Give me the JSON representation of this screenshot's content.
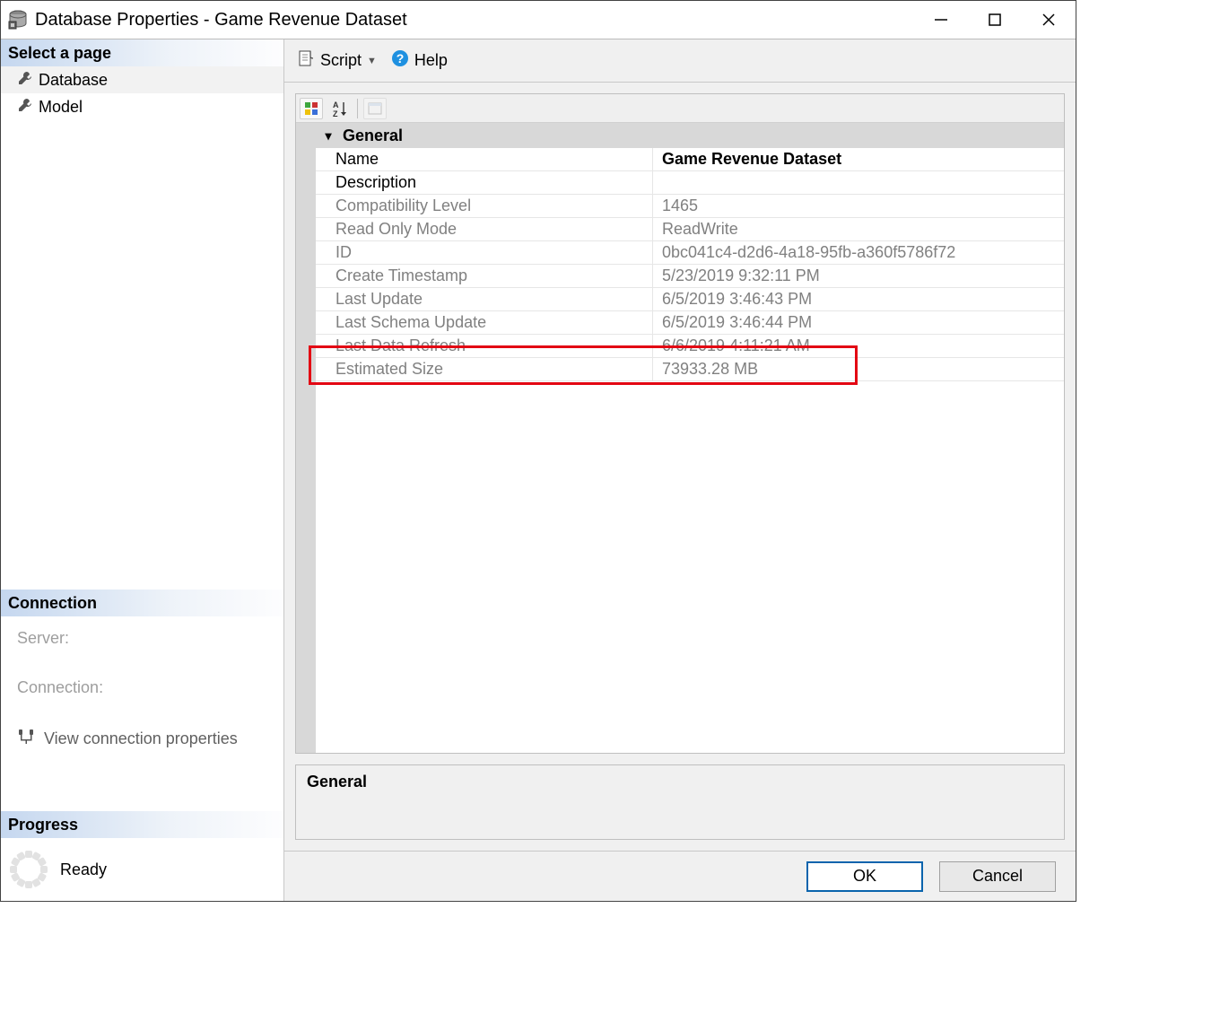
{
  "window": {
    "title": "Database Properties - Game Revenue Dataset"
  },
  "sidebar": {
    "select_page": "Select a page",
    "items": [
      {
        "label": "Database",
        "active": true
      },
      {
        "label": "Model",
        "active": false
      }
    ],
    "connection": {
      "header": "Connection",
      "server_label": "Server:",
      "connection_label": "Connection:",
      "link": "View connection properties"
    },
    "progress": {
      "header": "Progress",
      "status": "Ready"
    }
  },
  "toolbar": {
    "script": "Script",
    "help": "Help"
  },
  "grid": {
    "category": "General",
    "rows": [
      {
        "k": "Name",
        "v": "Game Revenue Dataset",
        "ro": false,
        "name": true
      },
      {
        "k": "Description",
        "v": "",
        "ro": false
      },
      {
        "k": "Compatibility Level",
        "v": "1465",
        "ro": true
      },
      {
        "k": "Read Only Mode",
        "v": "ReadWrite",
        "ro": true
      },
      {
        "k": "ID",
        "v": "0bc041c4-d2d6-4a18-95fb-a360f5786f72",
        "ro": true
      },
      {
        "k": "Create Timestamp",
        "v": "5/23/2019 9:32:11 PM",
        "ro": true
      },
      {
        "k": "Last Update",
        "v": "6/5/2019 3:46:43 PM",
        "ro": true
      },
      {
        "k": "Last Schema Update",
        "v": "6/5/2019 3:46:44 PM",
        "ro": true
      },
      {
        "k": "Last Data Refresh",
        "v": "6/6/2019 4:11:21 AM",
        "ro": true
      },
      {
        "k": "Estimated Size",
        "v": "73933.28 MB",
        "ro": true,
        "highlight": true
      }
    ]
  },
  "description_panel": {
    "title": "General"
  },
  "footer": {
    "ok": "OK",
    "cancel": "Cancel"
  }
}
